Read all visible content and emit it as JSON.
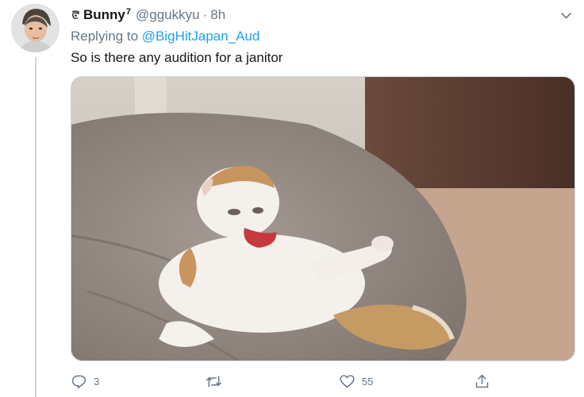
{
  "tweet": {
    "display_name": "Bunny",
    "name_superscript": "7",
    "handle": "@ggukkyu",
    "separator": "·",
    "time": "8h",
    "replying_to_prefix": "Replying to",
    "replying_to_handle": "@BigHitJapan_Aud",
    "text": "So is there any audition for a janitor",
    "actions": {
      "reply_count": "3",
      "retweet_count": "",
      "like_count": "55"
    }
  },
  "icons": {
    "badge": "flag-badge-icon",
    "menu": "chevron-down-icon",
    "reply": "reply-icon",
    "retweet": "retweet-icon",
    "like": "heart-icon",
    "share": "share-icon"
  },
  "colors": {
    "text": "#14171a",
    "secondary": "#657786",
    "link": "#1da1f2",
    "thread_line": "#ccd6dd"
  }
}
